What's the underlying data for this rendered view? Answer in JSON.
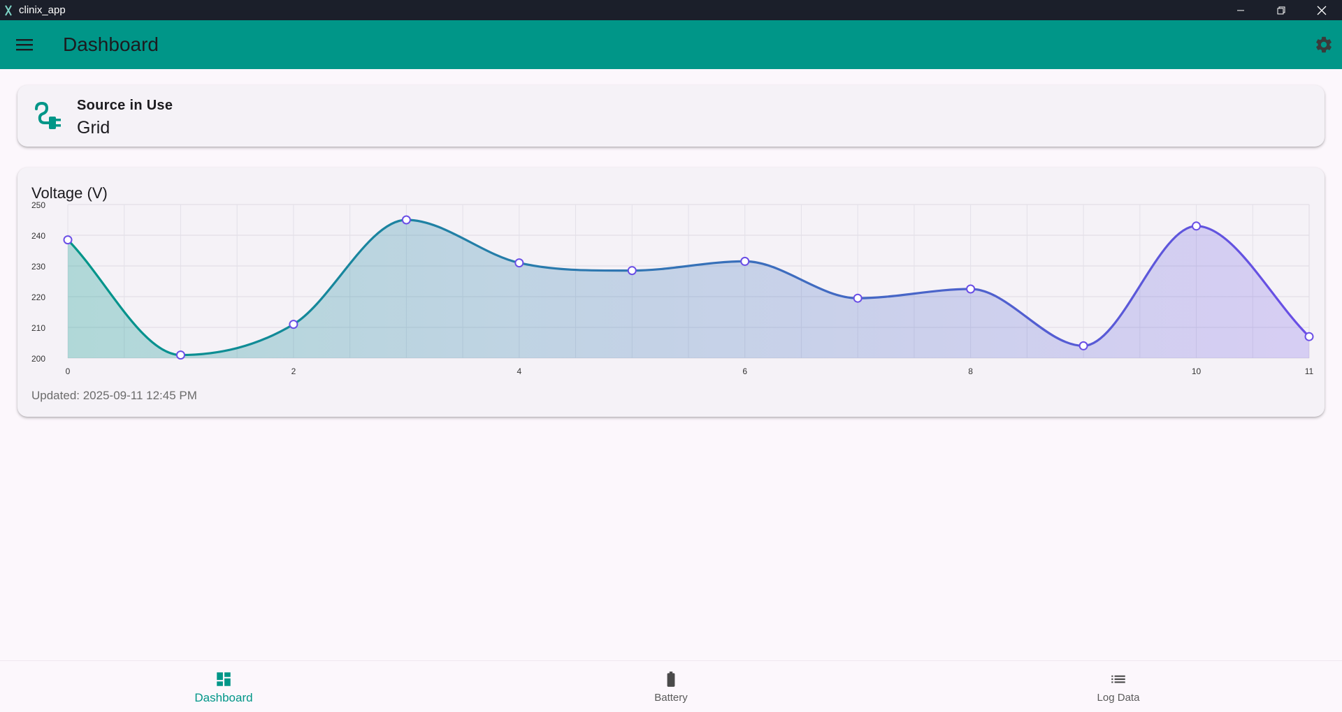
{
  "window": {
    "title": "clinix_app",
    "minimize_icon": "minimize-icon",
    "maximize_icon": "restore-icon",
    "close_icon": "close-icon"
  },
  "appbar": {
    "title": "Dashboard",
    "menu_icon": "menu-icon",
    "settings_icon": "gear-icon",
    "color": "#009688"
  },
  "source": {
    "label": "Source in Use",
    "value": "Grid",
    "icon": "power-plug-icon"
  },
  "voltage_card": {
    "title": "Voltage (V)",
    "updated": "Updated: 2025-09-11 12:45 PM"
  },
  "chart_data": {
    "type": "line",
    "title": "Voltage (V)",
    "xlabel": "",
    "ylabel": "",
    "x": [
      0,
      1,
      2,
      3,
      4,
      5,
      6,
      7,
      8,
      9,
      10,
      11
    ],
    "series": [
      {
        "values": [
          238.5,
          201,
          211,
          245,
          231,
          228.5,
          231.5,
          219.5,
          222.5,
          204,
          243,
          207
        ]
      }
    ],
    "xlim": [
      0,
      11
    ],
    "ylim": [
      200,
      250
    ],
    "x_ticks": [
      "0",
      "2",
      "4",
      "6",
      "8",
      "10",
      "11"
    ],
    "y_ticks": [
      "250",
      "240",
      "230",
      "220",
      "210",
      "200"
    ],
    "grid": true,
    "curved": true,
    "gradient_start": "#009688",
    "gradient_end": "#6a4ee6"
  },
  "bottom_nav": {
    "items": [
      {
        "label": "Dashboard",
        "icon": "dashboard-icon",
        "active": true
      },
      {
        "label": "Battery",
        "icon": "battery-icon",
        "active": false
      },
      {
        "label": "Log Data",
        "icon": "list-icon",
        "active": false
      }
    ]
  }
}
